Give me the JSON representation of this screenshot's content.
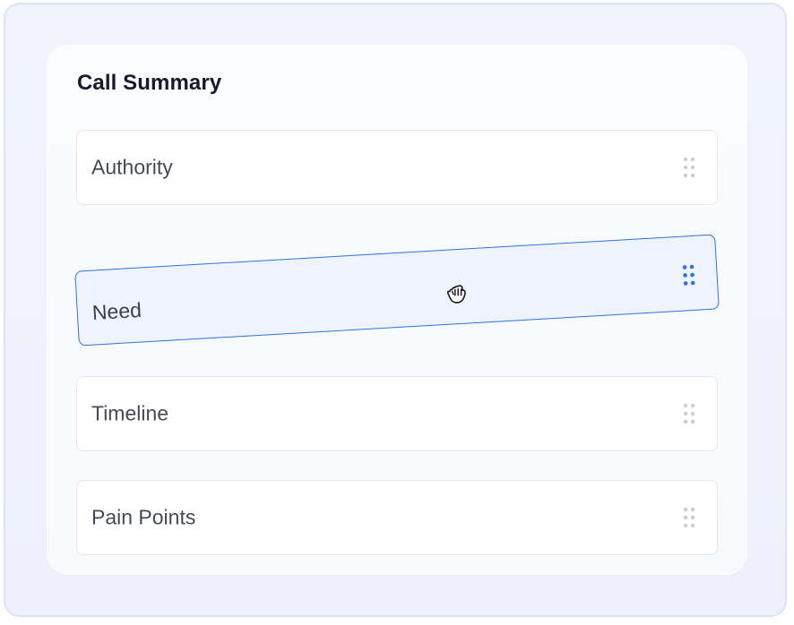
{
  "panel": {
    "title": "Call Summary"
  },
  "items": [
    {
      "label": "Authority",
      "state": "idle"
    },
    {
      "label": "Need",
      "state": "dragging"
    },
    {
      "label": "Timeline",
      "state": "idle"
    },
    {
      "label": "Pain Points",
      "state": "idle"
    }
  ],
  "icons": {
    "drag_handle": "grip-dots-icon",
    "cursor": "grab-hand-cursor-icon"
  },
  "colors": {
    "accent": "#2b74e0",
    "dragging_bg": "#eef3fd",
    "grip_idle": "#c9ccd4",
    "title": "#151a2c",
    "label": "#444a5a"
  }
}
